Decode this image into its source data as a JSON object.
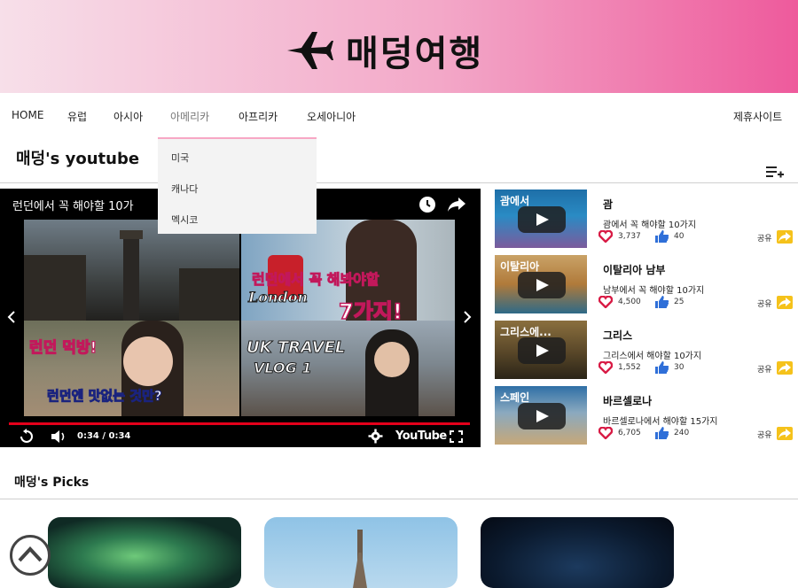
{
  "brand": {
    "title": "매덩여행",
    "icon": "airplane-icon"
  },
  "nav": {
    "items": [
      "HOME",
      "유럽",
      "아시아",
      "아메리카",
      "아프리카",
      "오세아니아"
    ],
    "partner": "제휴사이트",
    "dropdown": [
      "미국",
      "캐나다",
      "멕시코"
    ]
  },
  "youtube_section": {
    "title": "매덩's youtube"
  },
  "player": {
    "title": "런던에서 꼭 해야할 10가",
    "time": "0:34 / 0:34",
    "youtube_label": "YouTube",
    "thumb_texts": {
      "london": "London",
      "must_do": "런던에서 꼭 해봐야할",
      "seven": "7가지!",
      "mukbang": "런던 먹방!",
      "tasty": "런던엔 맛없는 것만?",
      "uk_travel": "UK TRAVEL",
      "vlog": "VLOG 1"
    }
  },
  "playlist": [
    {
      "title": "괌",
      "desc": "괌에서 꼭 해야할 10가지",
      "views": "3,737",
      "likes": "40",
      "share": "공유",
      "thumb_text": "괌에서"
    },
    {
      "title": "이탈리아 남부",
      "desc": "남부에서 꼭 해야할 10가지",
      "views": "4,500",
      "likes": "25",
      "share": "공유",
      "thumb_text": "이탈리아"
    },
    {
      "title": "그리스",
      "desc": "그리스에서 해야할 10가지",
      "views": "1,552",
      "likes": "30",
      "share": "공유",
      "thumb_text": "그리스에..."
    },
    {
      "title": "바르셀로나",
      "desc": "바르셀로나에서 해야할 15가지",
      "views": "6,705",
      "likes": "240",
      "share": "공유",
      "thumb_text": "스페인"
    }
  ],
  "picks": {
    "title": "매덩's Picks"
  }
}
